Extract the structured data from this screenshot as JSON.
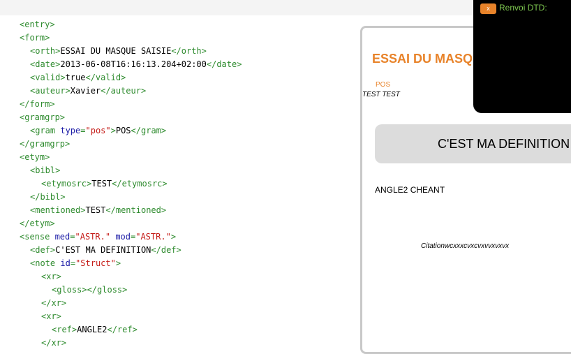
{
  "colors": {
    "tag": "#2e8b2e",
    "attr": "#1a1aa6",
    "value": "#c41a16",
    "accent": "#e8832a",
    "popup_bg": "#000000",
    "popup_text": "#7ec850"
  },
  "code_lines": [
    {
      "open": "<entry>"
    },
    {
      "open": "<form>"
    },
    {
      "open": "<orth>",
      "text": "ESSAI DU MASQUE SAISIE",
      "close": "</orth>"
    },
    {
      "open": "<date>",
      "text": "2013-06-08T16:16:13.204+02:00",
      "close": "</date>"
    },
    {
      "open": "<valid>",
      "text": "true",
      "close": "</valid>"
    },
    {
      "open": "<auteur>",
      "text": "Xavier",
      "close": "</auteur>"
    },
    {
      "open": "</form>"
    },
    {
      "open": "<gramgrp>"
    },
    {
      "open": "<gram ",
      "a1": "type",
      "eq1": "=",
      "v1": "\"pos\"",
      "end": ">",
      "text": "POS",
      "close": "</gram>"
    },
    {
      "open": "</gramgrp>"
    },
    {
      "open": "<etym>"
    },
    {
      "open": "<bibl>"
    },
    {
      "open": "<etymosrc>",
      "text": "TEST",
      "close": "</etymosrc>"
    },
    {
      "open": "</bibl>"
    },
    {
      "open": "<mentioned>",
      "text": "TEST",
      "close": "</mentioned>"
    },
    {
      "open": "</etym>"
    },
    {
      "open": "<sense ",
      "a1": "med",
      "eq1": "=",
      "v1": "\"ASTR.\"",
      "sp": " ",
      "a2": "mod",
      "eq2": "=",
      "v2": "\"ASTR.\"",
      "end": ">"
    },
    {
      "open": "<def>",
      "text": "C'EST MA DEFINITION",
      "close": "</def>"
    },
    {
      "open": "<note ",
      "a1": "id",
      "eq1": "=",
      "v1": "\"Struct\"",
      "end": ">"
    },
    {
      "open": "<xr>"
    },
    {
      "open": "<gloss></gloss>"
    },
    {
      "open": "</xr>"
    },
    {
      "open": "<xr>"
    },
    {
      "open": "<ref>",
      "text": "ANGLE2",
      "close": "</ref>"
    },
    {
      "open": "</xr>"
    }
  ],
  "preview": {
    "title": "ESSAI DU MASQUE SAISIE",
    "pos": "POS",
    "test": "TEST TEST",
    "definition": "C'EST MA DEFINITION",
    "angle": "ANGLE2 CHEANT",
    "citation": "Citationwcxxxcvxcvxvvxvxvx"
  },
  "dtd_popup": {
    "close_label": "x",
    "label": "Renvoi DTD:"
  }
}
